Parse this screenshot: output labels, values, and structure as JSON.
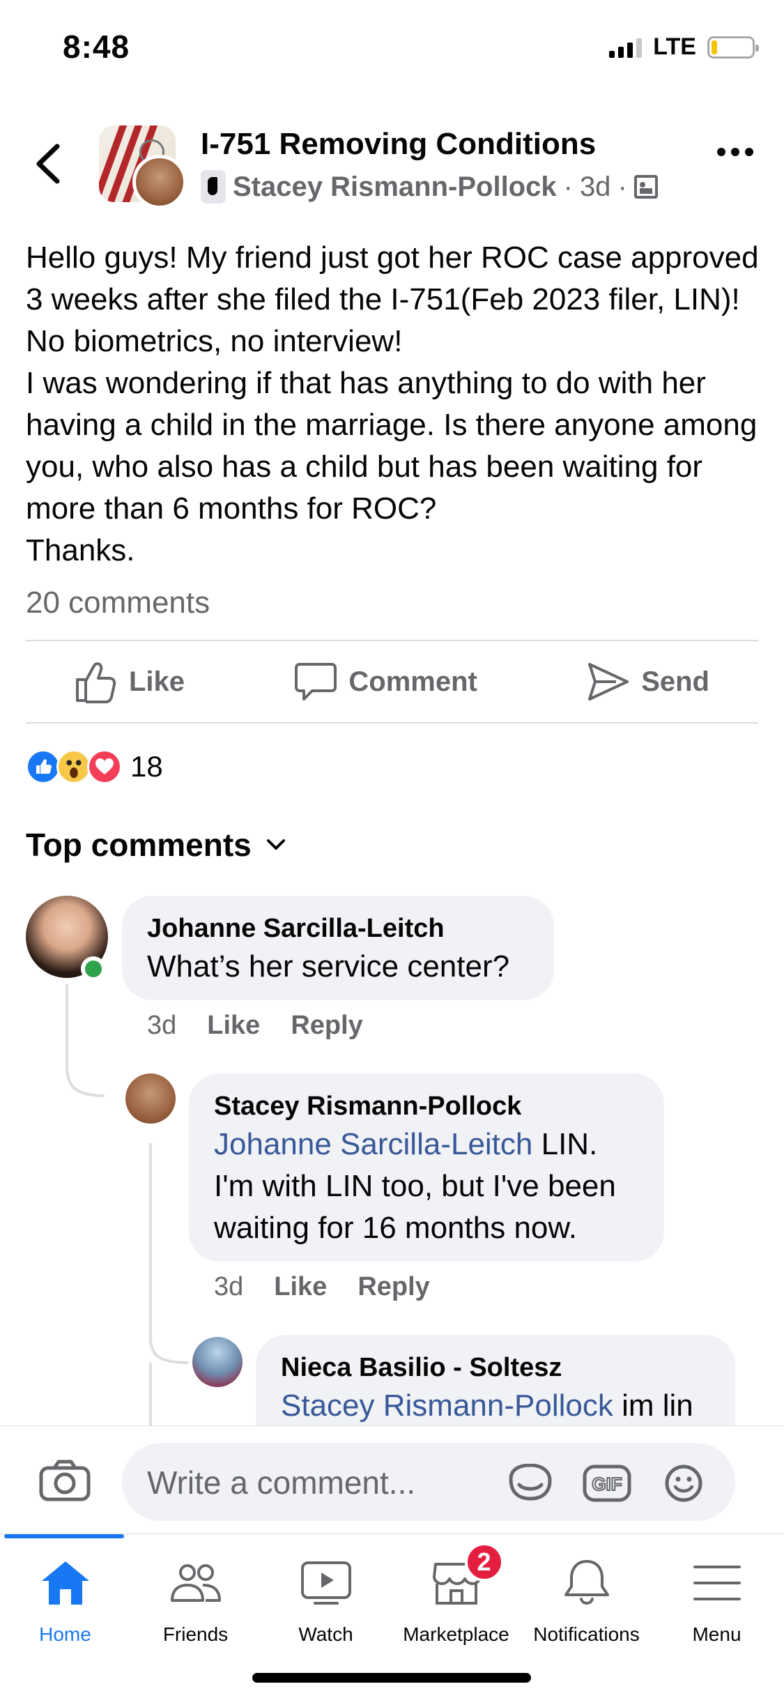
{
  "status_bar": {
    "time": "8:48",
    "network": "LTE"
  },
  "post": {
    "group_name": "I-751 Removing Conditions",
    "author": "Stacey Rismann-Pollock",
    "age": "3d",
    "body": "Hello guys! My friend just got her ROC case approved 3 weeks after she filed the I-751(Feb 2023 filer, LIN)! No biometrics, no interview!\nI was wondering if that has anything to do with her having a child in the marriage. Is there anyone among you, who also has a child but has been waiting for more than 6 months for ROC?\nThanks.",
    "comment_count": "20 comments",
    "actions": {
      "like": "Like",
      "comment": "Comment",
      "send": "Send"
    },
    "reaction_count": "18"
  },
  "top_comments_label": "Top comments",
  "comments": [
    {
      "name": "Johanne Sarcilla-Leitch",
      "text": "What’s her service center?",
      "age": "3d",
      "like": "Like",
      "reply": "Reply"
    },
    {
      "name": "Stacey Rismann-Pollock",
      "mention": "Johanne Sarcilla-Leitch",
      "text_after_mention": " LIN.",
      "text_lines": [
        "I'm with LIN too, but I've been",
        "waiting for 16 months now."
      ],
      "age": "3d",
      "like": "Like",
      "reply": "Reply"
    },
    {
      "name": "Nieca Basilio - Soltesz",
      "mention": "Stacey Rismann-Pollock",
      "text_after_mention": " im lin"
    }
  ],
  "composer": {
    "placeholder": "Write a comment..."
  },
  "tabs": [
    {
      "label": "Home",
      "active": true
    },
    {
      "label": "Friends"
    },
    {
      "label": "Watch"
    },
    {
      "label": "Marketplace",
      "badge": "2"
    },
    {
      "label": "Notifications"
    },
    {
      "label": "Menu"
    }
  ],
  "colors": {
    "accent": "#1877f2",
    "mention": "#385898",
    "badge": "#e41e3f",
    "online": "#31a24c"
  }
}
